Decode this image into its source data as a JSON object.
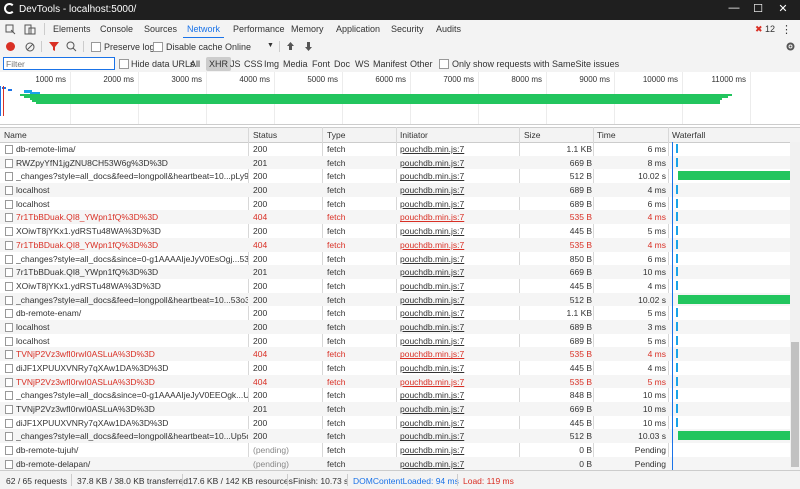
{
  "window": {
    "title": "DevTools - localhost:5000/",
    "min": "—",
    "max": "☐",
    "close": "✕"
  },
  "tabs": [
    "Elements",
    "Console",
    "Sources",
    "Network",
    "Performance",
    "Memory",
    "Application",
    "Security",
    "Audits"
  ],
  "error_count": "12",
  "toolbar": {
    "preserve_log": "Preserve log",
    "disable_cache": "Disable cache",
    "throttle": "Online"
  },
  "filter": {
    "placeholder": "Filter",
    "hide_data_urls": "Hide data URLs",
    "all": "All",
    "xhr": "XHR",
    "types": [
      "JS",
      "CSS",
      "Img",
      "Media",
      "Font",
      "Doc",
      "WS",
      "Manifest",
      "Other"
    ],
    "samesite": "Only show requests with SameSite issues"
  },
  "timeline_ticks": [
    "1000 ms",
    "2000 ms",
    "3000 ms",
    "4000 ms",
    "5000 ms",
    "6000 ms",
    "7000 ms",
    "8000 ms",
    "9000 ms",
    "10000 ms",
    "11000 ms"
  ],
  "columns": {
    "name": "Name",
    "status": "Status",
    "type": "Type",
    "initiator": "Initiator",
    "size": "Size",
    "time": "Time",
    "waterfall": "Waterfall"
  },
  "rows": [
    {
      "name": "db-remote-lima/",
      "status": "200",
      "type": "fetch",
      "initiator": "pouchdb.min.js:7",
      "size": "1.1 KB",
      "time": "6 ms",
      "err": false,
      "long": false
    },
    {
      "name": "RWZpyYfN1jgZNU8CH53W6g%3D%3D",
      "status": "201",
      "type": "fetch",
      "initiator": "pouchdb.min.js:7",
      "size": "669 B",
      "time": "8 ms",
      "err": false,
      "long": false
    },
    {
      "name": "_changes?style=all_docs&feed=longpoll&heartbeat=10...pLy98...",
      "status": "200",
      "type": "fetch",
      "initiator": "pouchdb.min.js:7",
      "size": "512 B",
      "time": "10.02 s",
      "err": false,
      "long": true
    },
    {
      "name": "localhost",
      "status": "200",
      "type": "fetch",
      "initiator": "pouchdb.min.js:7",
      "size": "689 B",
      "time": "4 ms",
      "err": false,
      "long": false
    },
    {
      "name": "localhost",
      "status": "200",
      "type": "fetch",
      "initiator": "pouchdb.min.js:7",
      "size": "689 B",
      "time": "6 ms",
      "err": false,
      "long": false
    },
    {
      "name": "7r1TbBDuak.QI8_YWpn1fQ%3D%3D",
      "status": "404",
      "type": "fetch",
      "initiator": "pouchdb.min.js:7",
      "size": "535 B",
      "time": "4 ms",
      "err": true,
      "long": false
    },
    {
      "name": "XOiwT8jYKx1.ydRSTu48WA%3D%3D",
      "status": "200",
      "type": "fetch",
      "initiator": "pouchdb.min.js:7",
      "size": "445 B",
      "time": "5 ms",
      "err": false,
      "long": false
    },
    {
      "name": "7r1TbBDuak.QI8_YWpn1fQ%3D%3D",
      "status": "404",
      "type": "fetch",
      "initiator": "pouchdb.min.js:7",
      "size": "535 B",
      "time": "4 ms",
      "err": true,
      "long": false
    },
    {
      "name": "_changes?style=all_docs&since=0-g1AAAAIjeJyV0EsOgj...53o3y...",
      "status": "200",
      "type": "fetch",
      "initiator": "pouchdb.min.js:7",
      "size": "850 B",
      "time": "6 ms",
      "err": false,
      "long": false
    },
    {
      "name": "7r1TbBDuak.QI8_YWpn1fQ%3D%3D",
      "status": "201",
      "type": "fetch",
      "initiator": "pouchdb.min.js:7",
      "size": "669 B",
      "time": "10 ms",
      "err": false,
      "long": false
    },
    {
      "name": "XOiwT8jYKx1.ydRSTu48WA%3D%3D",
      "status": "200",
      "type": "fetch",
      "initiator": "pouchdb.min.js:7",
      "size": "445 B",
      "time": "4 ms",
      "err": false,
      "long": false
    },
    {
      "name": "_changes?style=all_docs&feed=longpoll&heartbeat=10...53o3y...",
      "status": "200",
      "type": "fetch",
      "initiator": "pouchdb.min.js:7",
      "size": "512 B",
      "time": "10.02 s",
      "err": false,
      "long": true
    },
    {
      "name": "db-remote-enam/",
      "status": "200",
      "type": "fetch",
      "initiator": "pouchdb.min.js:7",
      "size": "1.1 KB",
      "time": "5 ms",
      "err": false,
      "long": false
    },
    {
      "name": "localhost",
      "status": "200",
      "type": "fetch",
      "initiator": "pouchdb.min.js:7",
      "size": "689 B",
      "time": "3 ms",
      "err": false,
      "long": false
    },
    {
      "name": "localhost",
      "status": "200",
      "type": "fetch",
      "initiator": "pouchdb.min.js:7",
      "size": "689 B",
      "time": "5 ms",
      "err": false,
      "long": false
    },
    {
      "name": "TVNjP2Vz3wfI0rwI0ASLuA%3D%3D",
      "status": "404",
      "type": "fetch",
      "initiator": "pouchdb.min.js:7",
      "size": "535 B",
      "time": "4 ms",
      "err": true,
      "long": false
    },
    {
      "name": "diJF1XPUUXVNRy7qXAw1DA%3D%3D",
      "status": "200",
      "type": "fetch",
      "initiator": "pouchdb.min.js:7",
      "size": "445 B",
      "time": "4 ms",
      "err": false,
      "long": false
    },
    {
      "name": "TVNjP2Vz3wfI0rwI0ASLuA%3D%3D",
      "status": "404",
      "type": "fetch",
      "initiator": "pouchdb.min.js:7",
      "size": "535 B",
      "time": "5 ms",
      "err": true,
      "long": false
    },
    {
      "name": "_changes?style=all_docs&since=0-g1AAAAIjeJyV0EEOgk...Up5d...",
      "status": "200",
      "type": "fetch",
      "initiator": "pouchdb.min.js:7",
      "size": "848 B",
      "time": "10 ms",
      "err": false,
      "long": false
    },
    {
      "name": "TVNjP2Vz3wfI0rwI0ASLuA%3D%3D",
      "status": "201",
      "type": "fetch",
      "initiator": "pouchdb.min.js:7",
      "size": "669 B",
      "time": "10 ms",
      "err": false,
      "long": false
    },
    {
      "name": "diJF1XPUUXVNRy7qXAw1DA%3D%3D",
      "status": "200",
      "type": "fetch",
      "initiator": "pouchdb.min.js:7",
      "size": "445 B",
      "time": "10 ms",
      "err": false,
      "long": false
    },
    {
      "name": "_changes?style=all_docs&feed=longpoll&heartbeat=10...Up5dc...",
      "status": "200",
      "type": "fetch",
      "initiator": "pouchdb.min.js:7",
      "size": "512 B",
      "time": "10.03 s",
      "err": false,
      "long": true
    },
    {
      "name": "db-remote-tujuh/",
      "status": "(pending)",
      "type": "fetch",
      "initiator": "pouchdb.min.js:7",
      "size": "0 B",
      "time": "Pending",
      "err": false,
      "long": false,
      "pending": true
    },
    {
      "name": "db-remote-delapan/",
      "status": "(pending)",
      "type": "fetch",
      "initiator": "pouchdb.min.js:7",
      "size": "0 B",
      "time": "Pending",
      "err": false,
      "long": false,
      "pending": true
    }
  ],
  "status_bar": {
    "requests": "62 / 65 requests",
    "transferred": "37.8 KB / 38.0 KB transferred",
    "resources": "17.6 KB / 142 KB resources",
    "finish": "Finish: 10.73 s",
    "dcl": "DOMContentLoaded: 94 ms",
    "load": "Load: 119 ms"
  },
  "colors": {
    "accent": "#1a73e8",
    "error": "#d93025",
    "dcl": "#1a73e8",
    "load": "#d93025",
    "bar": "#22c55e"
  }
}
